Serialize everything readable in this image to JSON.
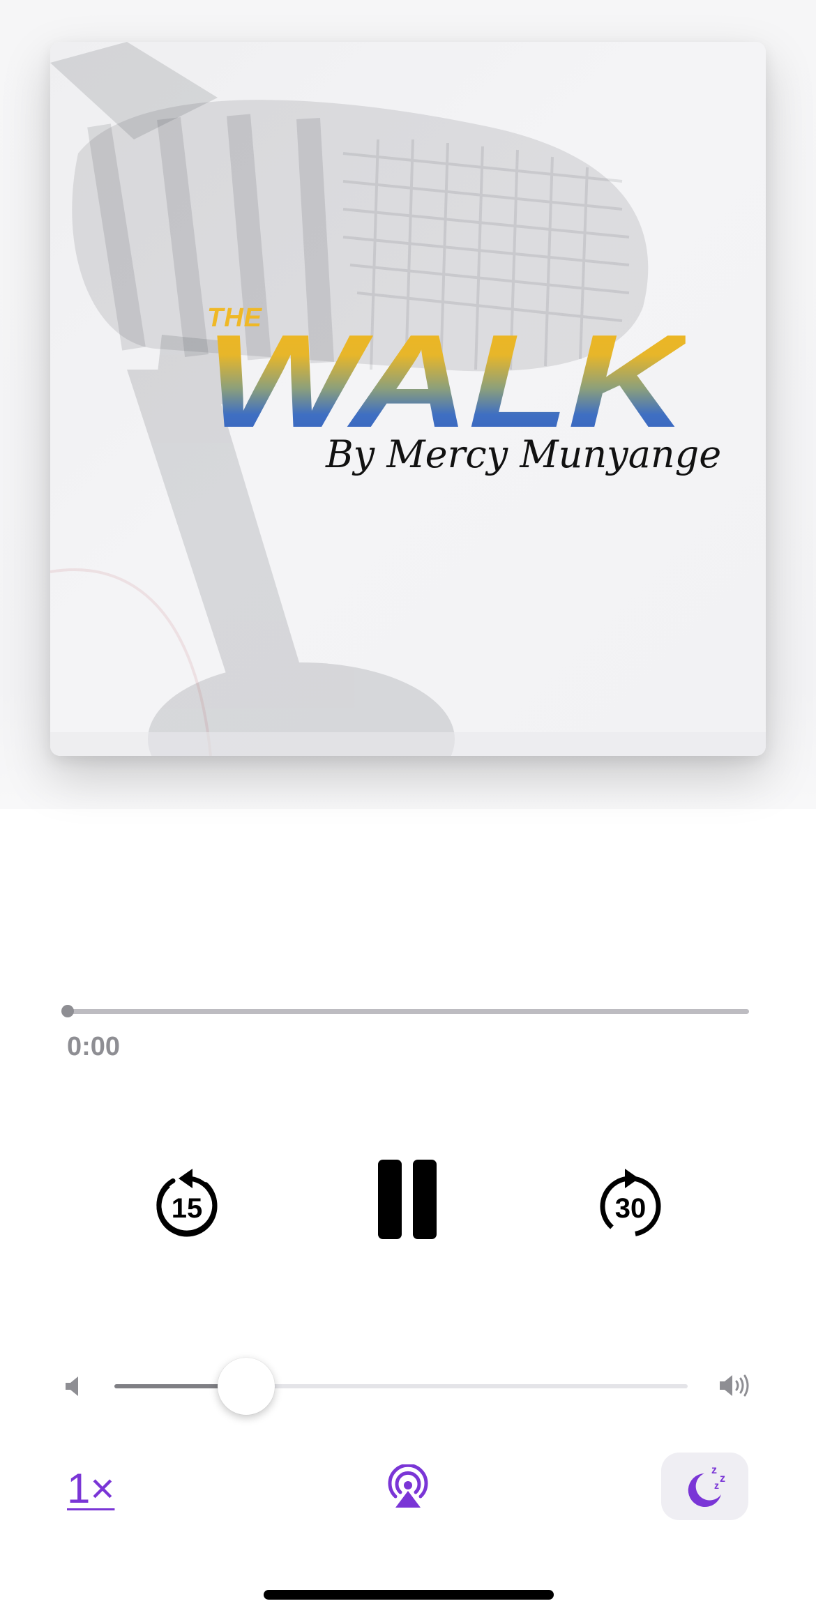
{
  "artwork": {
    "title_small": "THE",
    "title_large": "WALK",
    "subtitle": "By Mercy Munyange"
  },
  "playback": {
    "elapsed": "0:00",
    "progress_fraction": 0.0
  },
  "controls": {
    "skip_back_seconds": "15",
    "skip_forward_seconds": "30",
    "state": "playing"
  },
  "volume": {
    "level_fraction": 0.23
  },
  "bottom_bar": {
    "rate_label": "1×",
    "airplay_icon": "airplay-audio-icon",
    "sleep_icon": "sleep-timer-moon-icon"
  },
  "colors": {
    "accent": "#7a35d6",
    "logo_yellow": "#efb826",
    "logo_blue": "#3560bf"
  }
}
